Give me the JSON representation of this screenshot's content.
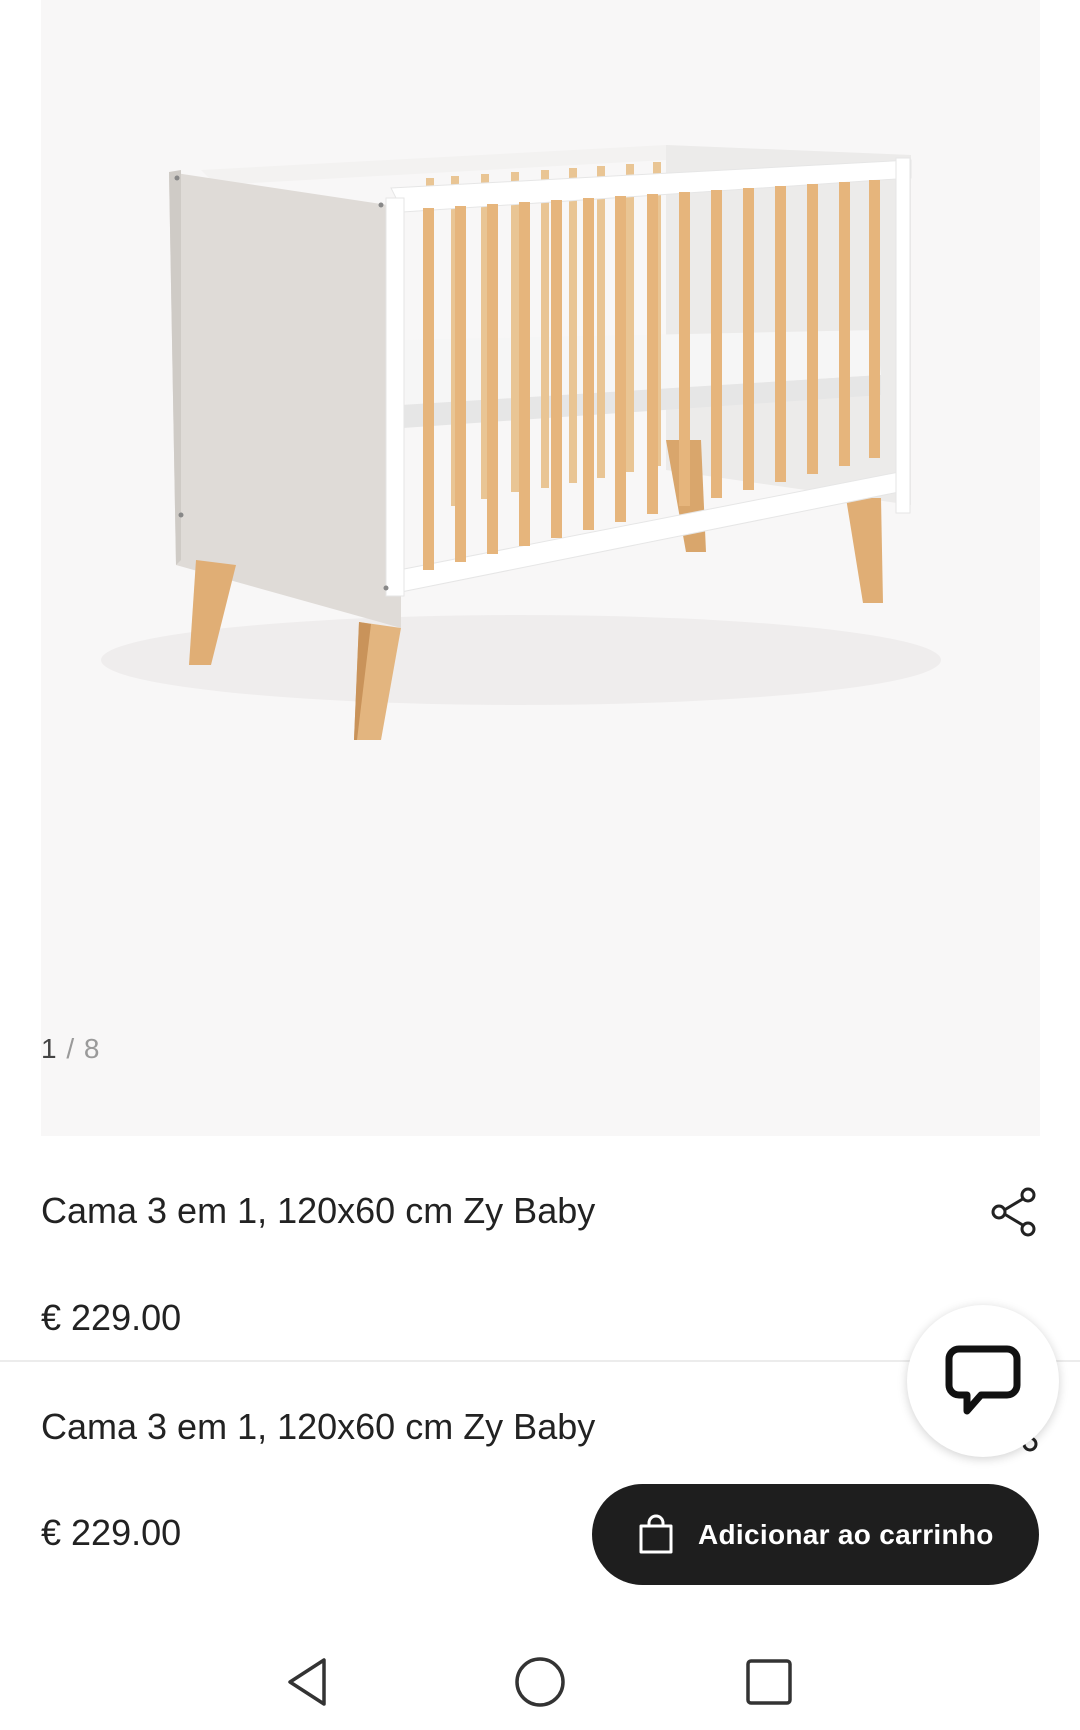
{
  "gallery": {
    "current": "1",
    "separator": "/",
    "total": "8",
    "image_alt": "crib-product-photo"
  },
  "product": {
    "title": "Cama 3 em 1, 120x60 cm Zy Baby",
    "price": "€ 229.00"
  },
  "sticky_bar": {
    "title": "Cama 3 em 1, 120x60 cm Zy Baby",
    "price": "€ 229.00",
    "add_to_cart_label": "Adicionar ao carrinho"
  },
  "icons": {
    "next": "chevron-right-icon",
    "share": "share-icon",
    "bag": "shopping-bag-icon",
    "chat": "chat-bubble-icon",
    "nav_back": "triangle-back-icon",
    "nav_home": "circle-home-icon",
    "nav_recents": "square-recents-icon"
  },
  "colors": {
    "button_bg": "#1e1e1e",
    "gallery_bg": "#f8f7f7",
    "wood": "#e3b57f"
  }
}
